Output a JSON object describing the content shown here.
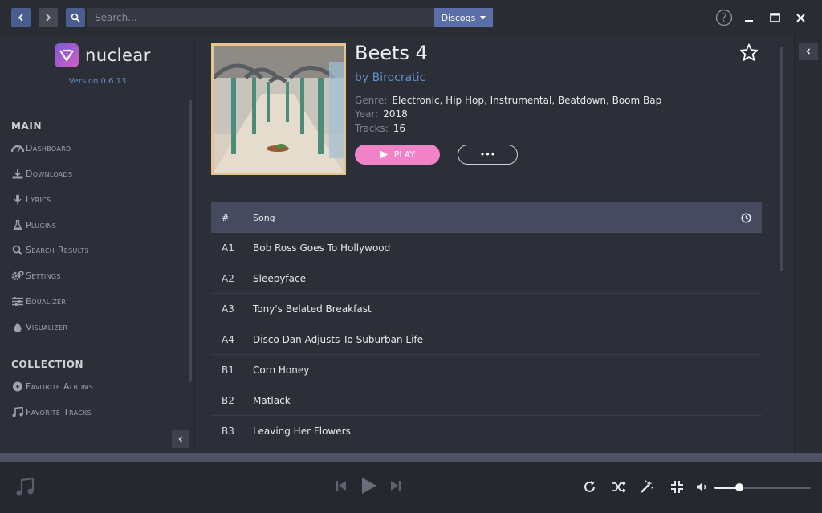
{
  "search": {
    "placeholder": "Search..."
  },
  "source": {
    "selected": "Discogs"
  },
  "app": {
    "logo_text": "nuclear",
    "version": "Version 0.6.13"
  },
  "sidebar": {
    "main_label": "MAIN",
    "collection_label": "COLLECTION",
    "main_items": [
      {
        "label": "Dashboard",
        "icon": "dashboard-icon"
      },
      {
        "label": "Downloads",
        "icon": "download-icon"
      },
      {
        "label": "Lyrics",
        "icon": "microphone-icon"
      },
      {
        "label": "Plugins",
        "icon": "flask-icon"
      },
      {
        "label": "Search Results",
        "icon": "search-icon"
      },
      {
        "label": "Settings",
        "icon": "gear-icon"
      },
      {
        "label": "Equalizer",
        "icon": "sliders-icon"
      },
      {
        "label": "Visualizer",
        "icon": "droplet-icon"
      }
    ],
    "collection_items": [
      {
        "label": "Favorite Albums",
        "icon": "disc-icon"
      },
      {
        "label": "Favorite Tracks",
        "icon": "music-icon"
      }
    ]
  },
  "album": {
    "title": "Beets 4",
    "artist": "by Birocratic",
    "genre_label": "Genre:",
    "genre": "Electronic, Hip Hop, Instrumental, Beatdown, Boom Bap",
    "year_label": "Year:",
    "year": "2018",
    "tracks_label": "Tracks:",
    "tracks_count": "16",
    "play_label": "PLAY",
    "more_label": "•••"
  },
  "tracklist": {
    "headers": {
      "number": "#",
      "song": "Song"
    },
    "rows": [
      {
        "num": "A1",
        "title": "Bob Ross Goes To Hollywood"
      },
      {
        "num": "A2",
        "title": "Sleepyface"
      },
      {
        "num": "A3",
        "title": "Tony's Belated Breakfast"
      },
      {
        "num": "A4",
        "title": "Disco Dan Adjusts To Suburban Life"
      },
      {
        "num": "B1",
        "title": "Corn Honey"
      },
      {
        "num": "B2",
        "title": "Matlack"
      },
      {
        "num": "B3",
        "title": "Leaving Her Flowers"
      }
    ]
  },
  "player": {
    "volume": 0.26
  },
  "colors": {
    "accent": "#4a5d8f",
    "play_pink": "#f183c8",
    "artist_blue": "#5e8fcf",
    "cover_border": "#e5c48f"
  }
}
